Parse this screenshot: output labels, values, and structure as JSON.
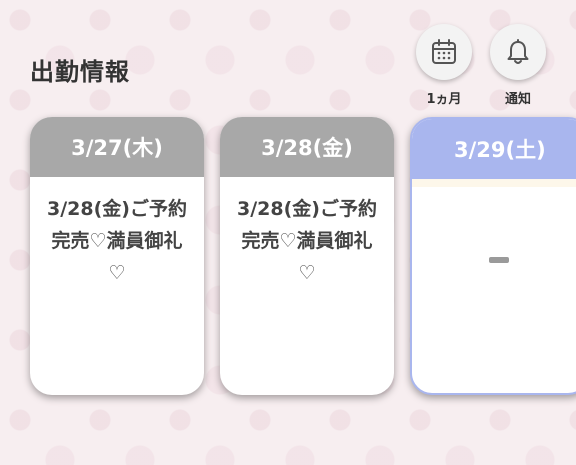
{
  "header": {
    "title": "出勤情報"
  },
  "actions": {
    "month_label": "1ヵ月",
    "notify_label": "通知"
  },
  "schedule": {
    "cards": [
      {
        "date": "3/27(木)",
        "line1": "3/28(金)ご予約",
        "line2": "完売♡満員御礼",
        "line3": "♡"
      },
      {
        "date": "3/28(金)",
        "line1": "3/28(金)ご予約",
        "line2": "完売♡満員御礼",
        "line3": "♡"
      },
      {
        "date": "3/29(土)",
        "status": "-"
      }
    ]
  },
  "colors": {
    "card_header_past": "#a8a8a8",
    "card_header_today": "#a9b6ee"
  }
}
